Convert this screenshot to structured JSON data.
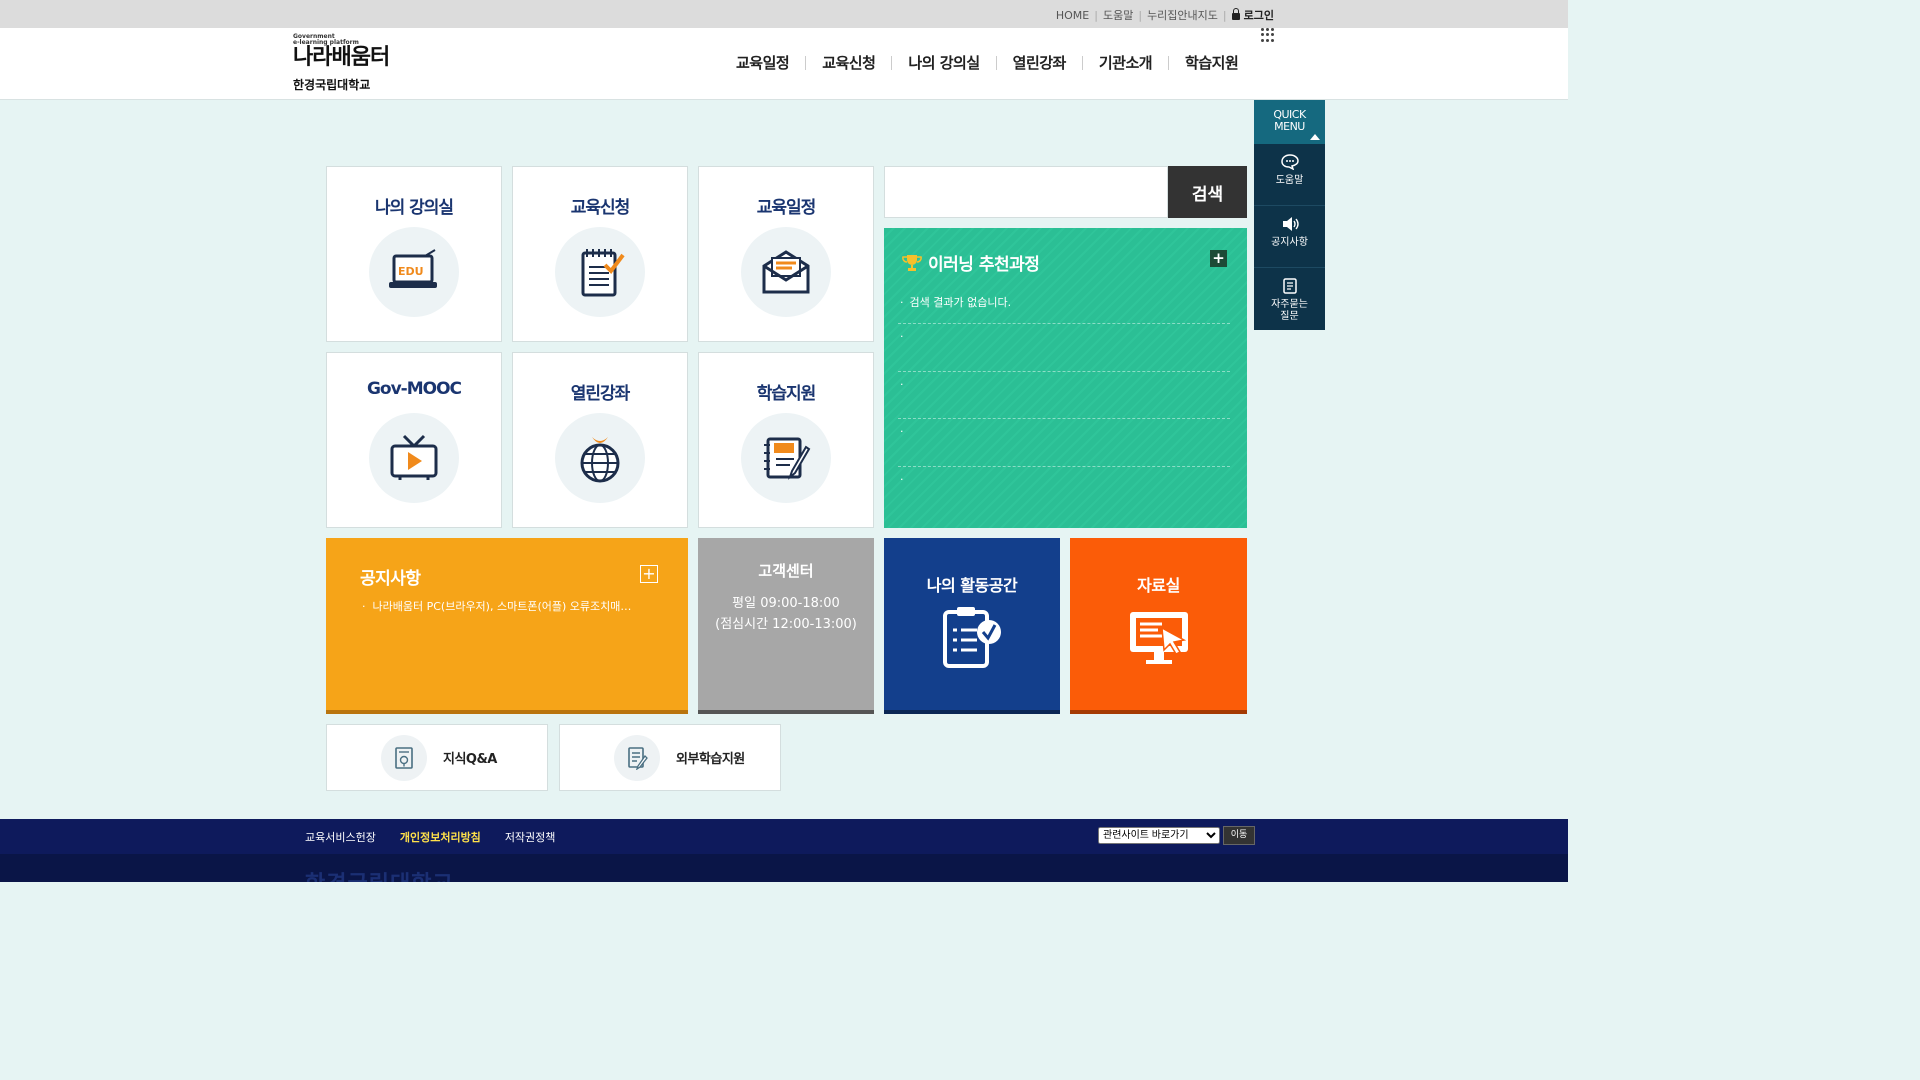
{
  "utilbar": {
    "home": "HOME",
    "help": "도움말",
    "sitemap": "누리집안내지도",
    "login": "로그인"
  },
  "header": {
    "logo_tiny1": "Government",
    "logo_tiny2": "e-learning platform",
    "logo_brand": "나라배움터",
    "school": "한경국립대학교",
    "nav": [
      "교육일정",
      "교육신청",
      "나의 강의실",
      "열린강좌",
      "기관소개",
      "학습지원"
    ]
  },
  "tiles": [
    {
      "title": "나의 강의실",
      "icon": "edu-laptop-icon"
    },
    {
      "title": "교육신청",
      "icon": "notepad-check-icon"
    },
    {
      "title": "교육일정",
      "icon": "envelope-icon"
    },
    {
      "title": "Gov-MOOC",
      "icon": "tv-play-icon"
    },
    {
      "title": "열린강좌",
      "icon": "globe-icon"
    },
    {
      "title": "학습지원",
      "icon": "notebook-pencil-icon"
    }
  ],
  "search": {
    "placeholder": "",
    "button": "검색"
  },
  "recommend": {
    "title": "이러닝 추천과정",
    "plus": "+",
    "items": [
      "검색 결과가 없습니다.",
      "",
      "",
      "",
      ""
    ]
  },
  "notice": {
    "title": "공지사항",
    "plus": "+",
    "item": "나라배움터 PC(브라우저), 스마트폰(어플) 오류조치매…"
  },
  "customer_center": {
    "title": "고객센터",
    "line1": "평일 09:00-18:00",
    "line2": "(점심시간 12:00-13:00)"
  },
  "activity": {
    "title": "나의 활동공간"
  },
  "library": {
    "title": "자료실"
  },
  "small_tiles": [
    {
      "label": "지식Q&A"
    },
    {
      "label": "외부학습지원"
    }
  ],
  "quick_menu": {
    "head_line1": "QUICK",
    "head_line2": "MENU",
    "items": [
      {
        "label": "도움말",
        "icon": "chat-bubble-icon"
      },
      {
        "label": "공지사항",
        "icon": "speaker-icon"
      },
      {
        "label": "자주묻는\n질문",
        "line1": "자주묻는",
        "line2": "질문",
        "icon": "faq-list-icon"
      }
    ]
  },
  "footer": {
    "links": [
      "교육서비스헌장",
      "개인정보처리방침",
      "저작권정책"
    ],
    "select_value": "관련사이트 바로가기",
    "go_button": "이동",
    "ghost_text": "한경국립대학교"
  },
  "colors": {
    "accent_navy": "#133f8c",
    "notice_orange": "#f6a418",
    "library_orange": "#fb5c08",
    "recommend_green": "#2bbf95",
    "footer_navy": "#0e1a5c",
    "quick_teal": "#15697f"
  }
}
